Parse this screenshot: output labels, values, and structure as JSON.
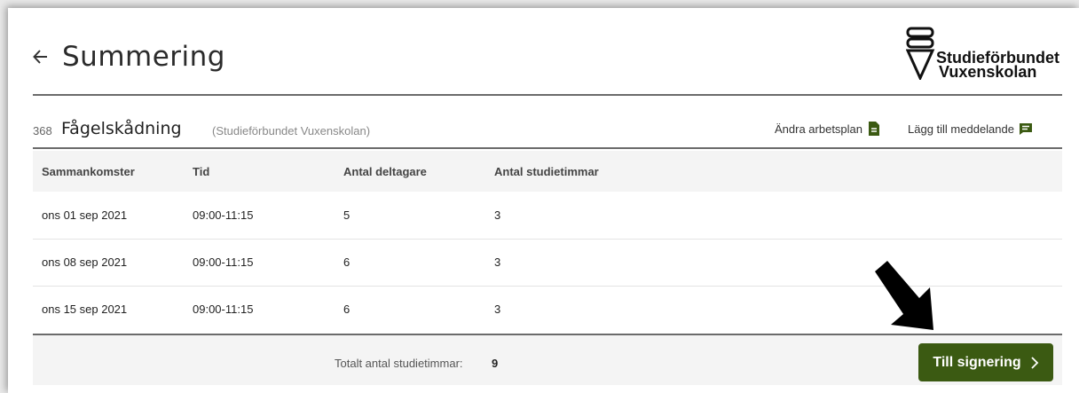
{
  "header": {
    "title": "Summering",
    "back_icon": "arrow-left-icon",
    "logo": {
      "line1": "Studieförbundet",
      "line2": "Vuxenskolan"
    }
  },
  "course": {
    "number": "368",
    "name": "Fågelskådning",
    "organization": "(Studieförbundet Vuxenskolan)",
    "actions": [
      {
        "label": "Ändra arbetsplan",
        "icon": "document-icon"
      },
      {
        "label": "Lägg till meddelande",
        "icon": "message-icon"
      }
    ]
  },
  "table": {
    "columns": [
      "Sammankomster",
      "Tid",
      "Antal deltagare",
      "Antal studietimmar"
    ],
    "rows": [
      [
        "ons 01 sep 2021",
        "09:00-11:15",
        "5",
        "3"
      ],
      [
        "ons 08 sep 2021",
        "09:00-11:15",
        "6",
        "3"
      ],
      [
        "ons 15 sep 2021",
        "09:00-11:15",
        "6",
        "3"
      ]
    ]
  },
  "footer": {
    "total_label": "Totalt antal studietimmar:",
    "total_value": "9",
    "sign_button": "Till signering",
    "sign_button_icon": "chevron-right-icon"
  },
  "colors": {
    "accent": "#3b5a12",
    "divider": "#6b6b6b",
    "row_bg": "#f4f4f4"
  }
}
